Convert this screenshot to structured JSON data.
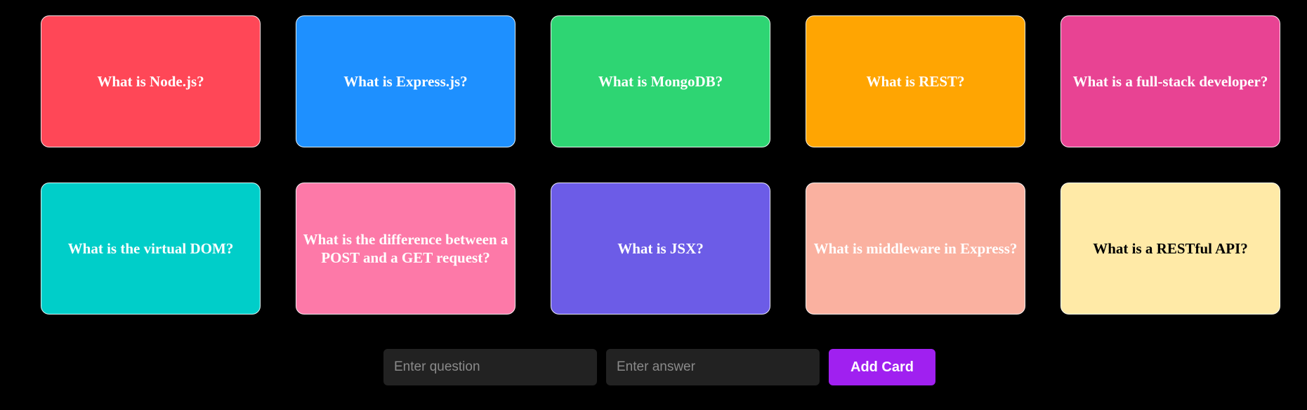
{
  "cards": [
    {
      "question": "What is Node.js?",
      "bg": "#ff4757",
      "fg": "#ffffff"
    },
    {
      "question": "What is Express.js?",
      "bg": "#1e90ff",
      "fg": "#ffffff"
    },
    {
      "question": "What is MongoDB?",
      "bg": "#2ed573",
      "fg": "#ffffff"
    },
    {
      "question": "What is REST?",
      "bg": "#ffa502",
      "fg": "#ffffff"
    },
    {
      "question": "What is a full-stack developer?",
      "bg": "#e84393",
      "fg": "#ffffff"
    },
    {
      "question": "What is the virtual DOM?",
      "bg": "#00cec9",
      "fg": "#ffffff"
    },
    {
      "question": "What is the difference between a POST and a GET request?",
      "bg": "#fd79a8",
      "fg": "#ffffff"
    },
    {
      "question": "What is JSX?",
      "bg": "#6c5ce7",
      "fg": "#ffffff"
    },
    {
      "question": "What is middleware in Express?",
      "bg": "#fab1a0",
      "fg": "#ffffff"
    },
    {
      "question": "What is a RESTful API?",
      "bg": "#ffeaa7",
      "fg": "#000000"
    }
  ],
  "form": {
    "question_placeholder": "Enter question",
    "answer_placeholder": "Enter answer",
    "add_label": "Add Card",
    "add_color": "#a020f0"
  }
}
